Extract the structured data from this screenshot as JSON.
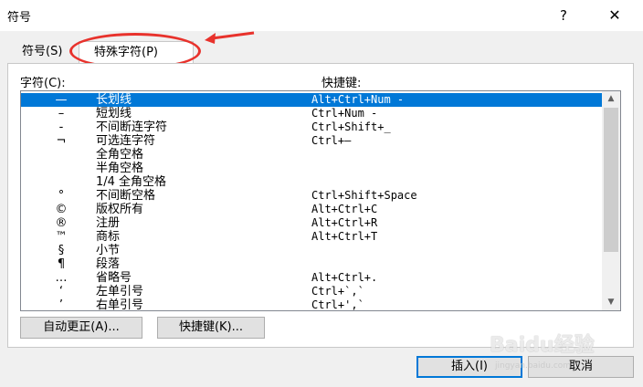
{
  "window": {
    "title": "符号",
    "help": "?",
    "close": "✕"
  },
  "tabs": [
    {
      "label": "符号(S)",
      "selected": false
    },
    {
      "label": "特殊字符(P)",
      "selected": true
    }
  ],
  "annotation_color": "#e8322c",
  "list": {
    "header_char": "字符(C):",
    "header_shortcut": "快捷键:",
    "rows": [
      {
        "glyph": "—",
        "name": "长划线",
        "shortcut": "Alt+Ctrl+Num -",
        "selected": true
      },
      {
        "glyph": "–",
        "name": "短划线",
        "shortcut": "Ctrl+Num -"
      },
      {
        "glyph": "‑",
        "name": "不间断连字符",
        "shortcut": "Ctrl+Shift+_"
      },
      {
        "glyph": "¬",
        "name": "可选连字符",
        "shortcut": "Ctrl+—"
      },
      {
        "glyph": "",
        "name": "全角空格",
        "shortcut": ""
      },
      {
        "glyph": "",
        "name": "半角空格",
        "shortcut": ""
      },
      {
        "glyph": "",
        "name": "1/4 全角空格",
        "shortcut": ""
      },
      {
        "glyph": "°",
        "name": "不间断空格",
        "shortcut": "Ctrl+Shift+Space"
      },
      {
        "glyph": "©",
        "name": "版权所有",
        "shortcut": "Alt+Ctrl+C"
      },
      {
        "glyph": "®",
        "name": "注册",
        "shortcut": "Alt+Ctrl+R"
      },
      {
        "glyph": "™",
        "name": "商标",
        "shortcut": "Alt+Ctrl+T"
      },
      {
        "glyph": "§",
        "name": "小节",
        "shortcut": ""
      },
      {
        "glyph": "¶",
        "name": "段落",
        "shortcut": ""
      },
      {
        "glyph": "…",
        "name": "省略号",
        "shortcut": "Alt+Ctrl+."
      },
      {
        "glyph": "‘",
        "name": "左单引号",
        "shortcut": "Ctrl+`,`"
      },
      {
        "glyph": "’",
        "name": "右单引号",
        "shortcut": "Ctrl+',`"
      }
    ]
  },
  "buttons": {
    "autocorrect": "自动更正(A)...",
    "shortcut_key": "快捷键(K)...",
    "insert": "插入(I)",
    "cancel": "取消"
  },
  "watermark": {
    "logo": "Baidu经验",
    "sub": "jingyan.baidu.com"
  }
}
